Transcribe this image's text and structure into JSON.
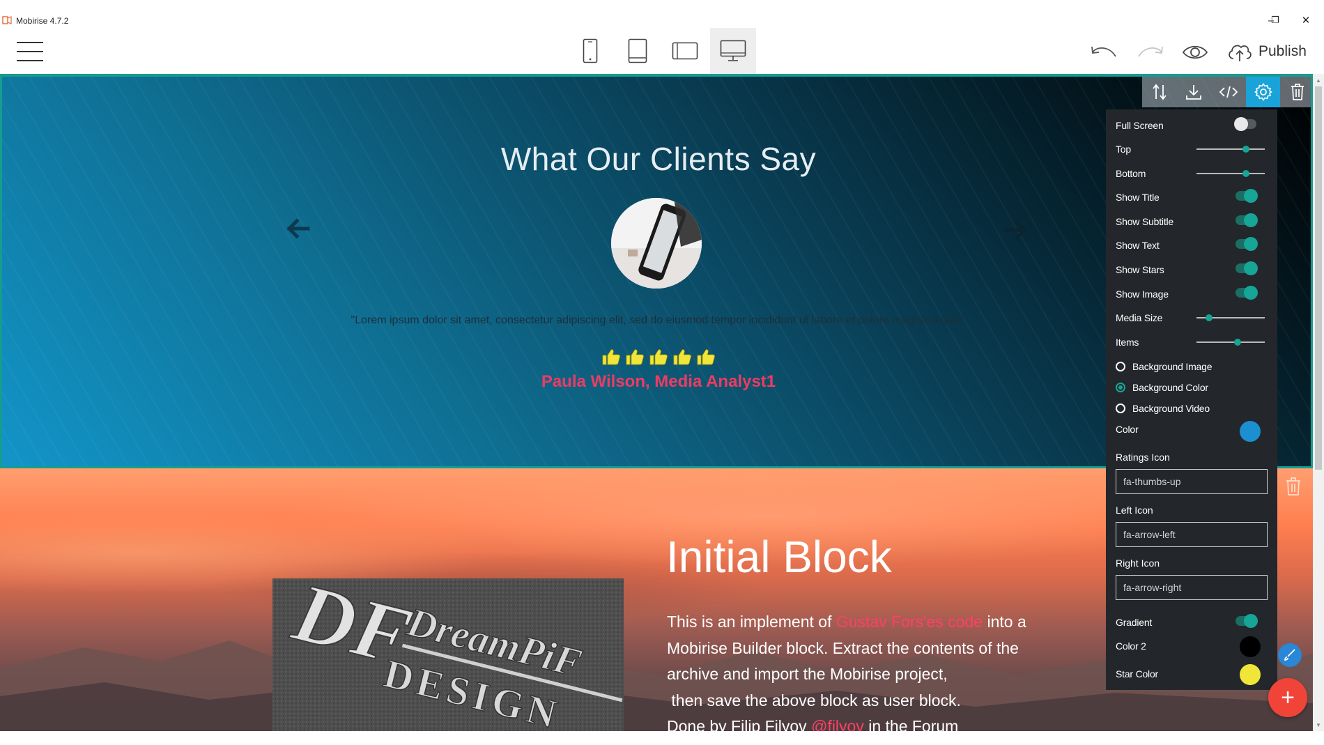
{
  "window": {
    "title": "Mobirise 4.7.2",
    "controls": {
      "minimize": "–",
      "restore": "❐",
      "close": "✕"
    }
  },
  "toolbar": {
    "devices": [
      {
        "name": "mobile",
        "icon": "phone-icon",
        "active": false
      },
      {
        "name": "tablet",
        "icon": "tablet-icon",
        "active": false
      },
      {
        "name": "tablet-landscape",
        "icon": "tablet-landscape-icon",
        "active": false
      },
      {
        "name": "desktop",
        "icon": "desktop-icon",
        "active": true
      }
    ],
    "icons": [
      "undo-icon",
      "redo-icon",
      "preview-eye-icon",
      "cloud-upload-icon"
    ],
    "publish_label": "Publish"
  },
  "block_toolbar": {
    "icons": [
      "reorder-arrows-icon",
      "save-download-icon",
      "code-icon",
      "gear-icon",
      "trash-icon"
    ],
    "active": "gear-icon"
  },
  "testimonials": {
    "title": "What Our Clients Say",
    "quote": "\"Lorem ipsum dolor sit amet, consectetur adipiscing elit, sed do eiusmod tempor incididunt ut labore et dolore magna aliqua.\"",
    "rating_count": 5,
    "rating_icon": "thumbs-up-icon",
    "author": "Paula Wilson, Media Analyst1",
    "left_icon": "arrow-left-icon",
    "right_icon": "arrow-right-icon"
  },
  "initial_block": {
    "title": "Initial Block",
    "text_1": "This is an implement of ",
    "link_1": "Gustav Fors'es code",
    "text_2": " into a Mobirise Builder block. Extract the contents of the archive and import the Mobirise project,",
    "text_3": " then save the above block as user block.",
    "text_4": "Done by Filip Filyov ",
    "link_2": "@filyov",
    "text_5": " in the Forum",
    "image_text_line1": "DreamPiF",
    "image_text_line2": "DESIGN",
    "image_monogram": "DF"
  },
  "settings": {
    "full_screen": {
      "label": "Full Screen",
      "on": false
    },
    "top": {
      "label": "Top",
      "value": 0.72
    },
    "bottom": {
      "label": "Bottom",
      "value": 0.72
    },
    "show_title": {
      "label": "Show Title",
      "on": true
    },
    "show_subtitle": {
      "label": "Show Subtitle",
      "on": true
    },
    "show_text": {
      "label": "Show Text",
      "on": true
    },
    "show_stars": {
      "label": "Show Stars",
      "on": true
    },
    "show_image": {
      "label": "Show Image",
      "on": true
    },
    "media_size": {
      "label": "Media Size",
      "value": 0.18
    },
    "items": {
      "label": "Items",
      "value": 0.6
    },
    "background": {
      "options": [
        "Background Image",
        "Background Color",
        "Background Video"
      ],
      "selected": "Background Color"
    },
    "color": {
      "label": "Color",
      "value": "#1c8fd0"
    },
    "ratings_icon": {
      "label": "Ratings Icon",
      "value": "fa-thumbs-up"
    },
    "left_icon": {
      "label": "Left Icon",
      "value": "fa-arrow-left"
    },
    "right_icon": {
      "label": "Right Icon",
      "value": "fa-arrow-right"
    },
    "gradient": {
      "label": "Gradient",
      "on": true
    },
    "color2": {
      "label": "Color 2",
      "value": "#000000"
    },
    "star_color": {
      "label": "Star Color",
      "value": "#f2e53a"
    }
  },
  "colors": {
    "accent": "#16a596",
    "active_blue": "#1aa3d9",
    "author_pink": "#ee3b62",
    "fab_red": "#f04438"
  }
}
